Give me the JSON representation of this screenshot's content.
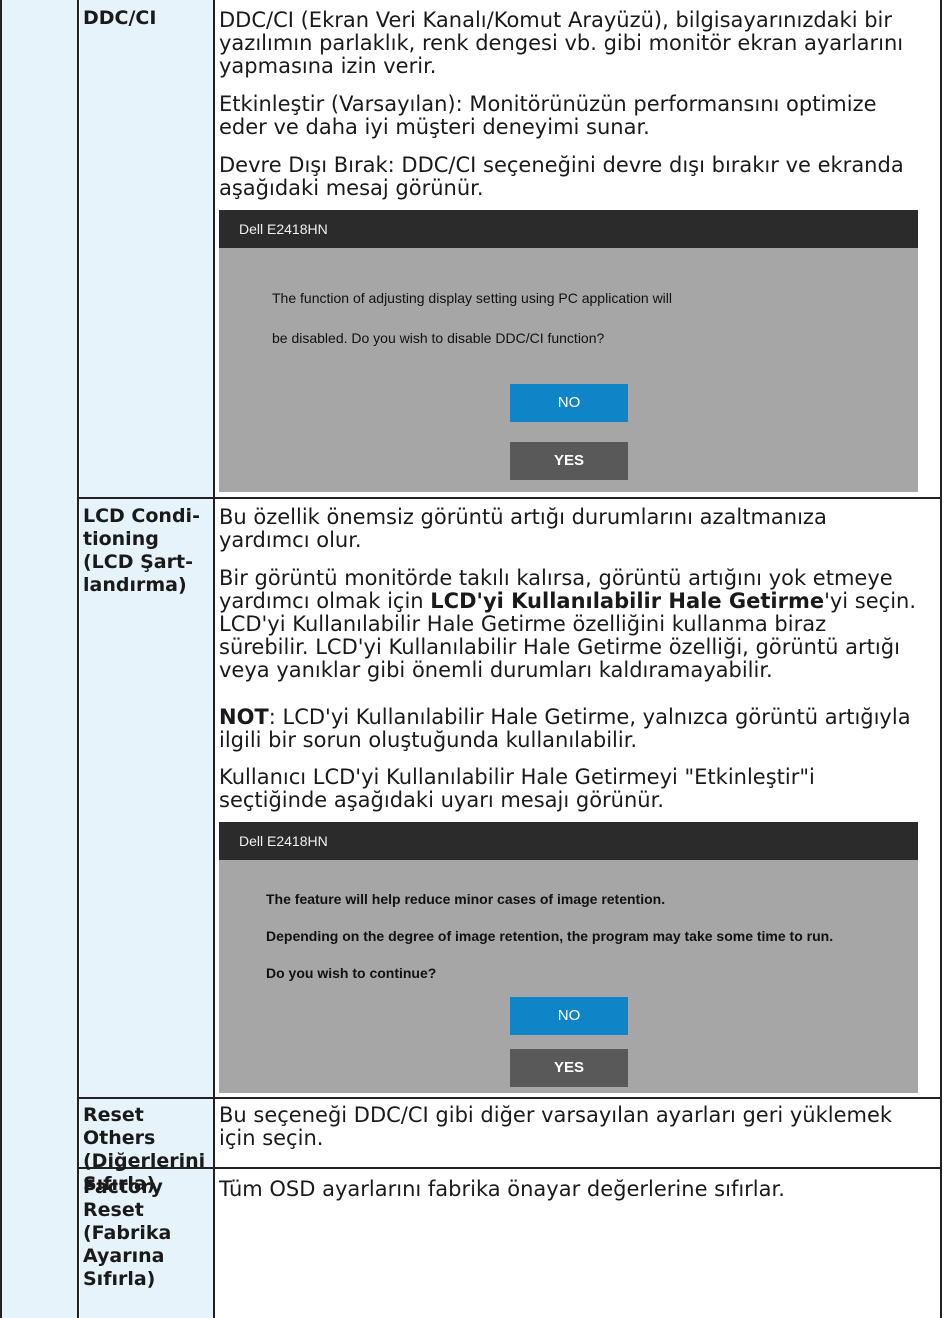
{
  "rows": {
    "ddc": {
      "label": "DDC/CI",
      "p1a": "DDC/CI (Ekran Veri Kanalı/Komut Arayüzü), bilgisayarınızdaki bir",
      "p1b": "yazılımın parlaklık, renk dengesi vb. gibi monitör ekran ayarlarını",
      "p1c": "yapmasına izin verir.",
      "p2a": "Etkinleştir (Varsayılan): Monitörünüzün performansını optimize",
      "p2b": "eder ve daha iyi müşteri deneyimi sunar.",
      "p3a": "Devre Dışı Bırak: DDC/CI seçeneğini devre dışı bırakır ve ekranda",
      "p3b": "aşağıdaki mesaj görünür.",
      "dialog": {
        "title": "Dell E2418HN",
        "line1": "The function of adjusting display setting using PC application will",
        "line2": "be disabled. Do you wish to disable DDC/CI function?",
        "no": "NO",
        "yes": "YES"
      }
    },
    "lcd": {
      "label1": "LCD Condi-",
      "label2": "tioning",
      "label3": "(LCD Şart-",
      "label4": "landırma)",
      "p1a": "Bu özellik önemsiz görüntü artığı durumlarını azaltmanıza",
      "p1b": "yardımcı olur.",
      "p2a": "Bir görüntü monitörde takılı kalırsa, görüntü artığını yok etmeye",
      "p2b_pre": "yardımcı olmak için ",
      "p2b_bold": "LCD'yi Kullanılabilir Hale Getirme",
      "p2b_post": "'yi seçin.",
      "p2c": "LCD'yi Kullanılabilir Hale Getirme özelliğini kullanma biraz",
      "p2d": "sürebilir. LCD'yi Kullanılabilir Hale Getirme özelliği, görüntü artığı",
      "p2e": "veya yanıklar gibi önemli durumları kaldıramayabilir.",
      "p3a_bold": "NOT",
      "p3a_rest": ": LCD'yi Kullanılabilir Hale Getirme, yalnızca görüntü artığıyla",
      "p3b": "ilgili bir sorun oluştuğunda kullanılabilir.",
      "p4a": "Kullanıcı LCD'yi Kullanılabilir Hale Getirmeyi \"Etkinleştir\"i",
      "p4b": "seçtiğinde aşağıdaki uyarı mesajı görünür.",
      "dialog": {
        "title": "Dell E2418HN",
        "line1": "The feature will help reduce minor cases of image retention.",
        "line2": "Depending on the degree of image retention, the program may take some time to run.",
        "line3": "Do you wish to continue?",
        "no": "NO",
        "yes": "YES"
      }
    },
    "reset_others": {
      "label1": "Reset Others",
      "label2": "(Diğerlerini",
      "label3": "Sıfırla)",
      "p1a": "Bu seçeneği DDC/CI gibi diğer varsayılan ayarları geri yüklemek",
      "p1b": "için seçin."
    },
    "factory": {
      "label1": "Factory",
      "label2": "Reset",
      "label3": "(Fabrika",
      "label4": "Ayarına",
      "label5": "Sıfırla)",
      "p1": "Tüm OSD ayarlarını fabrika önayar değerlerine sıfırlar."
    }
  }
}
